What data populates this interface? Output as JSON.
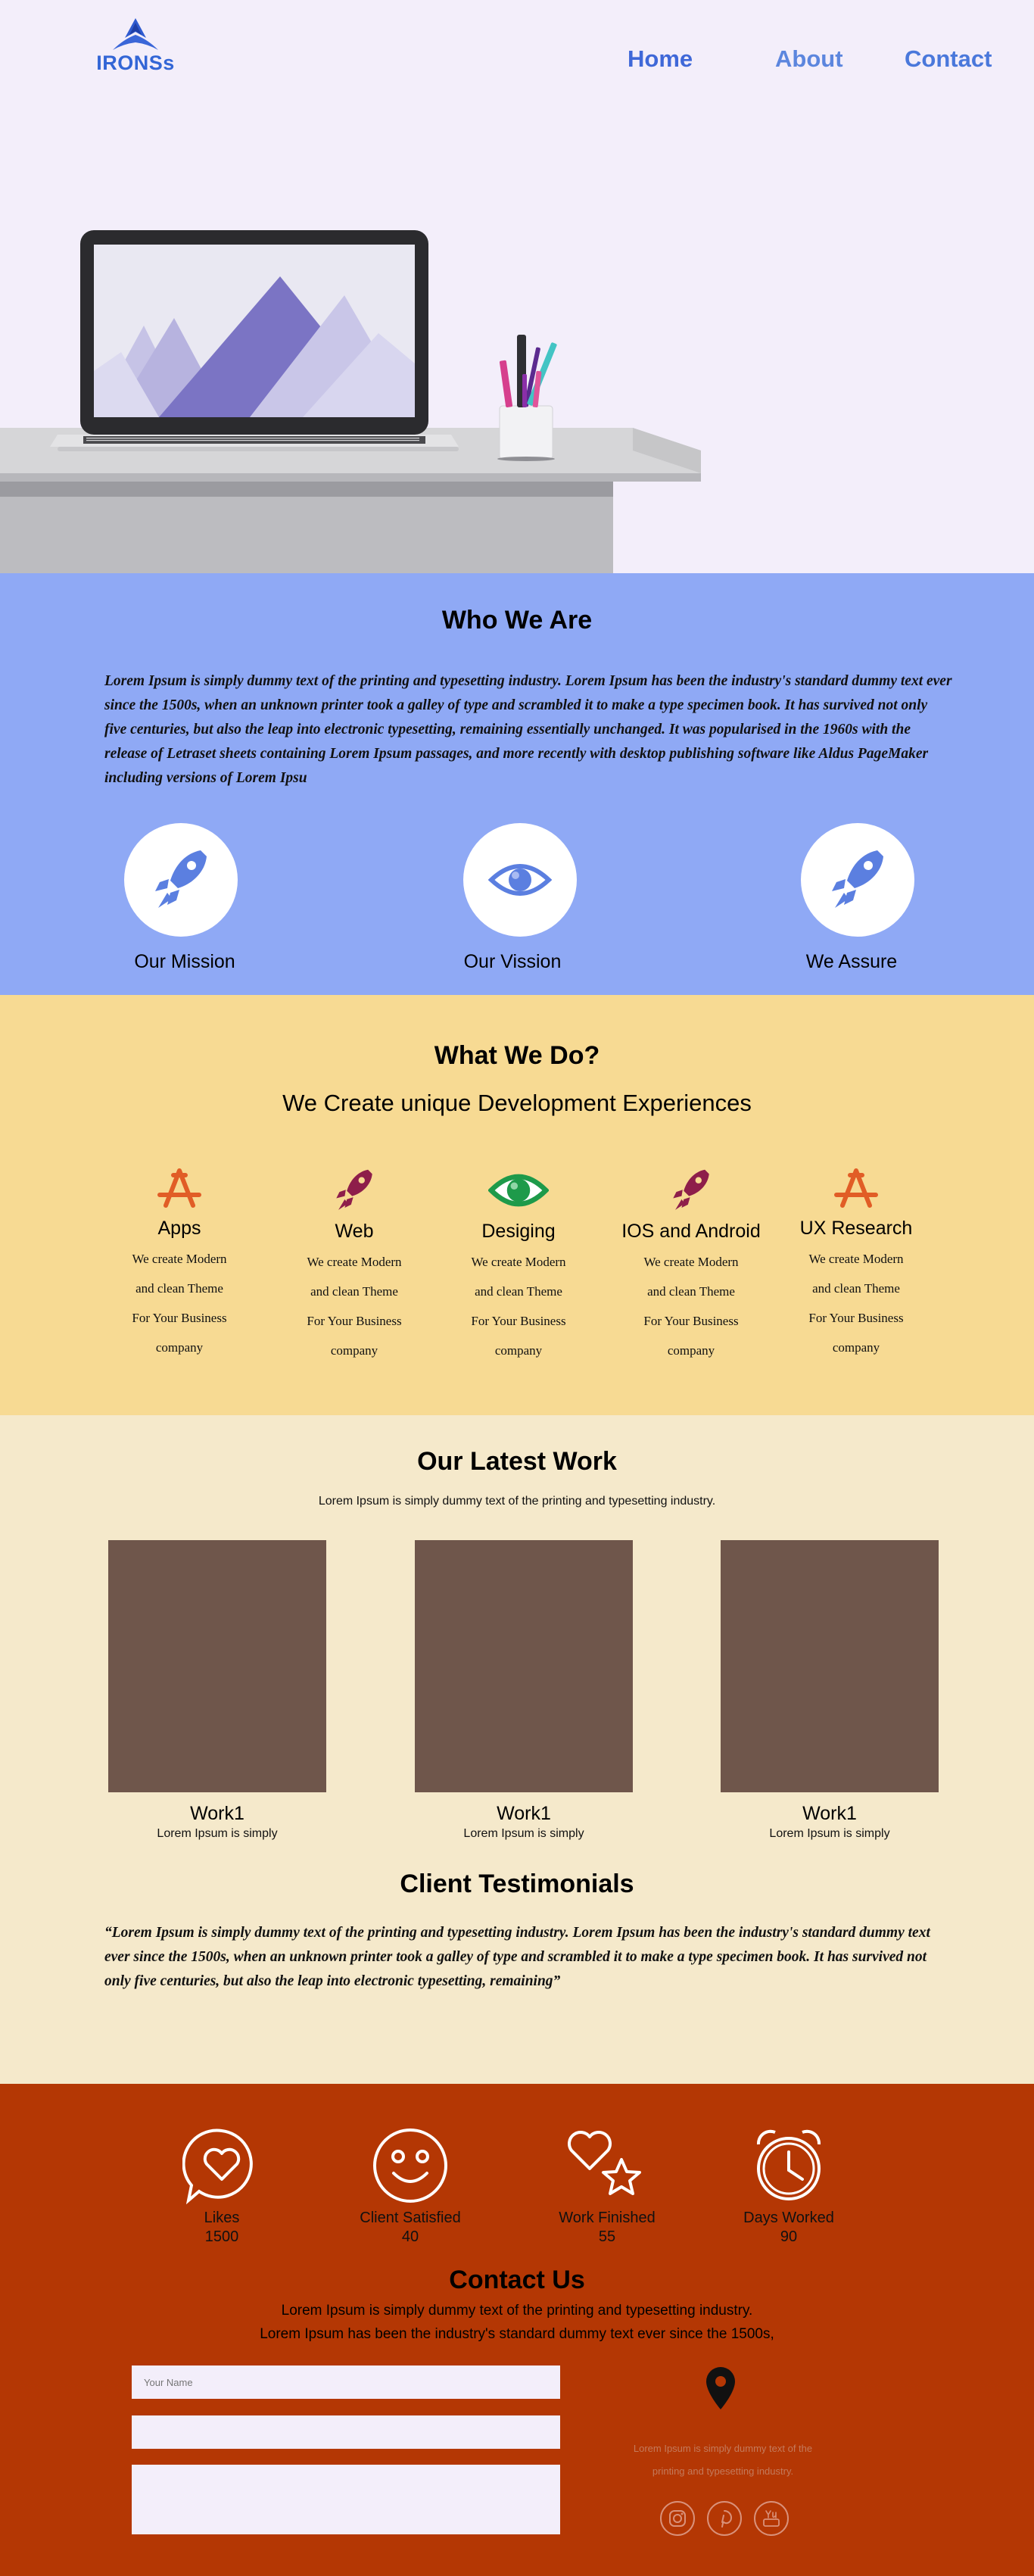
{
  "header": {
    "logo_text": "IRONSs",
    "nav": {
      "home": "Home",
      "about": "About",
      "contact": "Contact"
    }
  },
  "who": {
    "title": "Who We Are",
    "text": "Lorem Ipsum is simply dummy text of the printing and typesetting industry. Lorem Ipsum has been the industry's standard dummy text ever since the 1500s, when an unknown printer took a galley of type and scrambled it to make a type specimen book. It has survived not only five centuries, but also the leap into electronic typesetting, remaining essentially unchanged. It was popularised in the 1960s with the release of Letraset sheets containing Lorem Ipsum passages, and more recently with desktop publishing software like Aldus PageMaker including versions of Lorem Ipsu",
    "items": [
      {
        "label": "Our Mission",
        "icon": "rocket-icon"
      },
      {
        "label": "Our Vission",
        "icon": "eye-icon"
      },
      {
        "label": "We Assure",
        "icon": "rocket-icon"
      }
    ]
  },
  "what": {
    "title": "What We Do?",
    "subtitle": "We Create unique Development Experiences",
    "services": [
      {
        "name": "Apps",
        "icon": "app-store-icon",
        "desc": [
          "We create Modern",
          "and clean Theme",
          "For Your Business",
          "company"
        ]
      },
      {
        "name": "Web",
        "icon": "rocket-icon",
        "desc": [
          "We create Modern",
          "and clean Theme",
          "For Your Business",
          "company"
        ]
      },
      {
        "name": "Desiging",
        "icon": "eye-icon",
        "desc": [
          "We create Modern",
          "and clean Theme",
          "For Your Business",
          "company"
        ]
      },
      {
        "name": "IOS and Android",
        "icon": "rocket-icon",
        "desc": [
          "We create Modern",
          "and clean Theme",
          "For Your Business",
          "company"
        ]
      },
      {
        "name": "UX Research",
        "icon": "app-store-icon",
        "desc": [
          "We create Modern",
          "and clean Theme",
          "For Your Business",
          "company"
        ]
      }
    ]
  },
  "latest": {
    "title": "Our Latest Work",
    "subtitle": "Lorem Ipsum is simply dummy text of the printing and typesetting industry.",
    "works": [
      {
        "name": "Work1",
        "desc": "Lorem Ipsum is simply"
      },
      {
        "name": "Work1",
        "desc": "Lorem Ipsum is simply"
      },
      {
        "name": "Work1",
        "desc": "Lorem Ipsum is simply"
      }
    ]
  },
  "testimonials": {
    "title": "Client Testimonials",
    "text": "“Lorem Ipsum is simply dummy text of the printing and typesetting industry. Lorem Ipsum has been the industry's standard dummy text ever since the 1500s, when an unknown printer took a galley of type and scrambled it to make a type specimen book. It has survived not only five centuries, but also the leap into electronic typesetting, remaining”"
  },
  "stats": [
    {
      "label": "Likes",
      "value": "1500",
      "icon": "heart-chat-icon"
    },
    {
      "label": "Client Satisfied",
      "value": "40",
      "icon": "smiley-icon"
    },
    {
      "label": "Work Finished",
      "value": "55",
      "icon": "heart-star-icon"
    },
    {
      "label": "Days Worked",
      "value": "90",
      "icon": "alarm-clock-icon"
    }
  ],
  "contact": {
    "title": "Contact Us",
    "line1": "Lorem Ipsum is simply dummy text of the printing and typesetting industry.",
    "line2": "Lorem Ipsum has been the industry's standard dummy text ever since the 1500s,",
    "name_placeholder": "Your Name",
    "email_placeholder": "",
    "message_placeholder": "",
    "address_line1": "Lorem Ipsum is simply dummy text of the",
    "address_line2": "printing and typesetting industry."
  },
  "social": [
    "instagram-icon",
    "pinterest-icon",
    "youtube-icon"
  ],
  "colors": {
    "accent": "#3366d6",
    "who_bg": "#8fa9f5",
    "what_bg": "#f7da93",
    "latest_bg": "#f5e9cb",
    "footer_bg": "#b43704",
    "work_placeholder": "#6f564b"
  }
}
